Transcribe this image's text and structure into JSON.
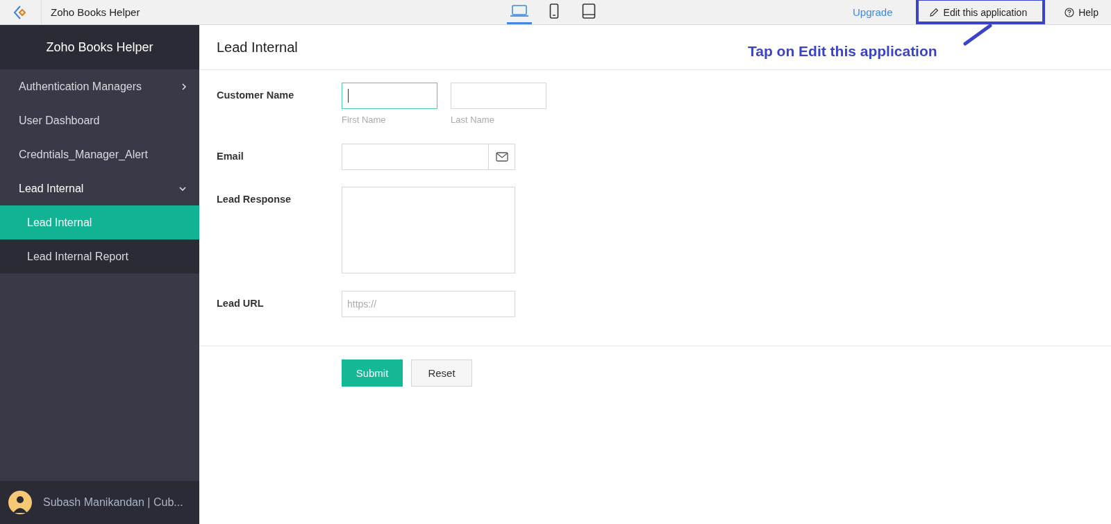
{
  "topbar": {
    "app_name": "Zoho Books Helper",
    "devices": [
      {
        "kind": "laptop",
        "selected": true
      },
      {
        "kind": "phone",
        "selected": false
      },
      {
        "kind": "tablet",
        "selected": false
      }
    ],
    "upgrade": "Upgrade",
    "edit_button": "Edit this application",
    "help": "Help"
  },
  "annotation": {
    "text": "Tap on Edit this application"
  },
  "sidebar": {
    "title": "Zoho Books Helper",
    "items": [
      {
        "label": "Authentication Managers",
        "expandable": true,
        "expanded": false,
        "selected": false
      },
      {
        "label": "User Dashboard",
        "expandable": false,
        "expanded": false,
        "selected": false
      },
      {
        "label": "Credntials_Manager_Alert",
        "expandable": false,
        "expanded": false,
        "selected": false
      },
      {
        "label": "Lead Internal",
        "expandable": true,
        "expanded": true,
        "selected": false,
        "children": [
          {
            "label": "Lead Internal",
            "selected": true
          },
          {
            "label": "Lead Internal Report",
            "selected": false
          }
        ]
      }
    ],
    "user": "Subash Manikandan | Cub..."
  },
  "form": {
    "title": "Lead Internal",
    "fields": [
      {
        "kind": "name",
        "label": "Customer Name",
        "parts": [
          {
            "caption": "First Name",
            "focused": true
          },
          {
            "caption": "Last Name",
            "focused": false
          }
        ]
      },
      {
        "kind": "email",
        "label": "Email"
      },
      {
        "kind": "textarea",
        "label": "Lead Response"
      },
      {
        "kind": "url",
        "label": "Lead URL",
        "placeholder": "https://"
      }
    ],
    "submit": "Submit",
    "reset": "Reset"
  }
}
